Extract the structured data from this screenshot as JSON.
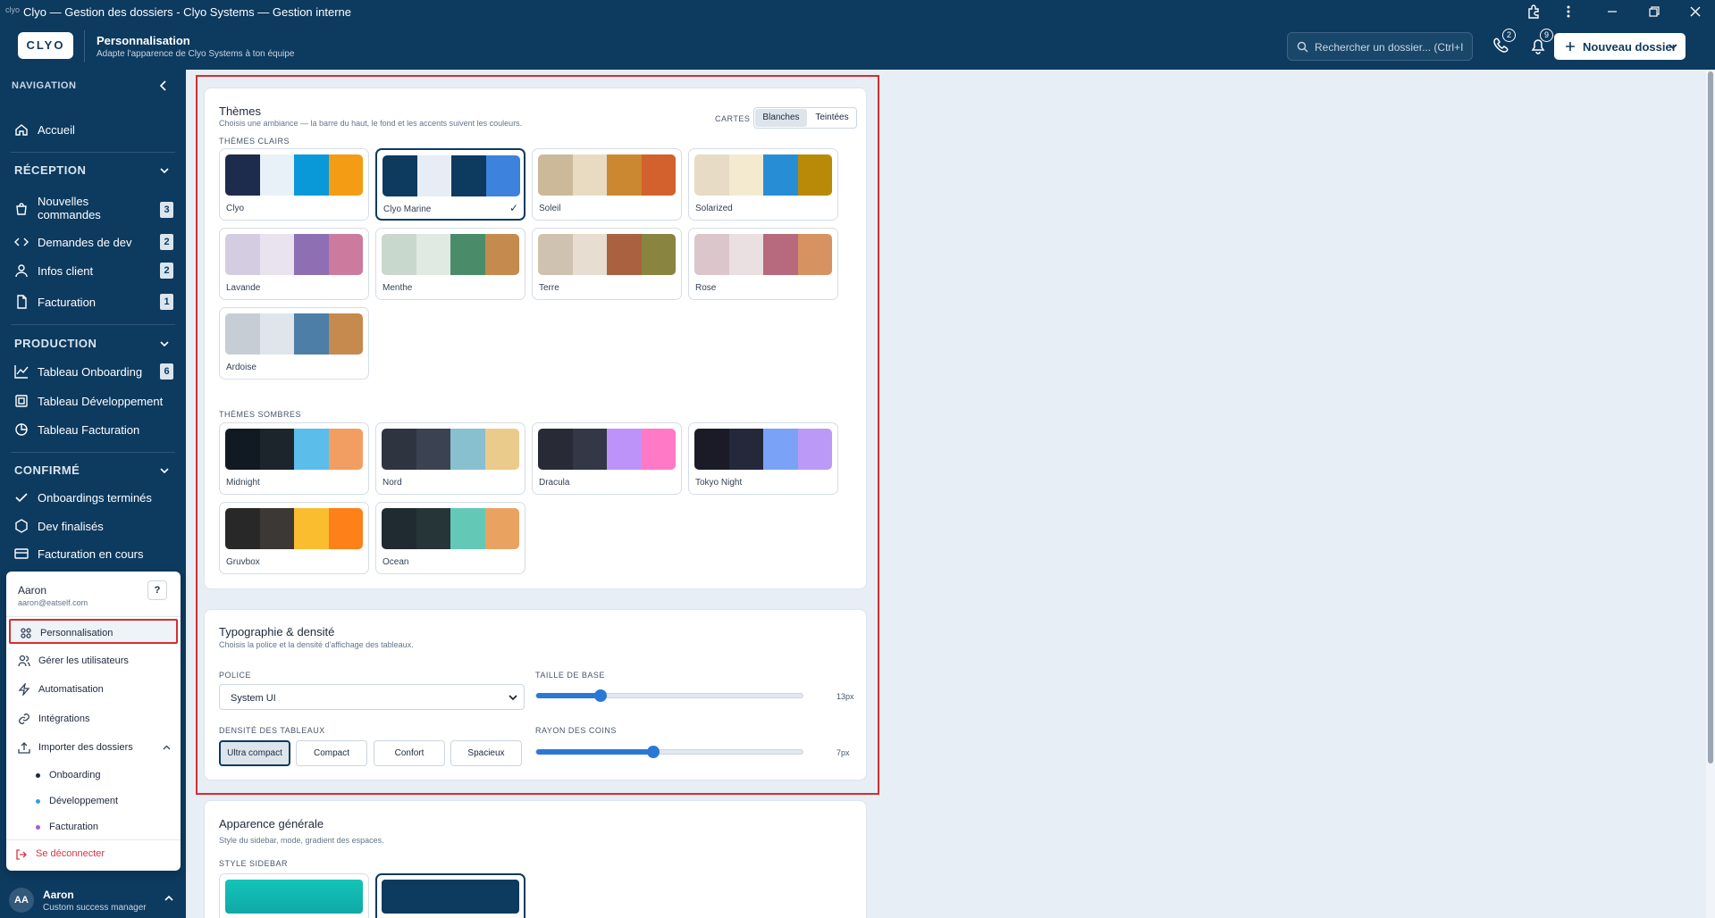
{
  "titlebar": {
    "logo_text": "clyo",
    "title": "Clyo — Gestion des dossiers - Clyo Systems — Gestion interne"
  },
  "header": {
    "logo": "CLYO",
    "title": "Personnalisation",
    "subtitle": "Adapte l'apparence de Clyo Systems à ton équipe",
    "search_placeholder": "Rechercher un dossier...  (Ctrl+I",
    "calls_count": "2",
    "notifications_count": "9",
    "new_button": "Nouveau dossier"
  },
  "sidebar": {
    "nav_heading": "NAVIGATION",
    "home": "Accueil",
    "sections": [
      {
        "title": "RÉCEPTION",
        "items": [
          {
            "label": "Nouvelles commandes",
            "count": "3"
          },
          {
            "label": "Demandes de dev",
            "count": "2"
          },
          {
            "label": "Infos client",
            "count": "2"
          },
          {
            "label": "Facturation",
            "count": "1"
          }
        ]
      },
      {
        "title": "PRODUCTION",
        "items": [
          {
            "label": "Tableau Onboarding",
            "count": "6"
          },
          {
            "label": "Tableau Développement"
          },
          {
            "label": "Tableau Facturation"
          }
        ]
      },
      {
        "title": "CONFIRMÉ",
        "items": [
          {
            "label": "Onboardings terminés"
          },
          {
            "label": "Dev finalisés"
          },
          {
            "label": "Facturation en cours"
          }
        ]
      }
    ],
    "nouvelles_line1": "Nouvelles",
    "nouvelles_line2": "commandes"
  },
  "popup": {
    "name": "Aaron",
    "email": "aaron@eatself.com",
    "help": "?",
    "items": [
      "Personnalisation",
      "Gérer les utilisateurs",
      "Automatisation",
      "Intégrations",
      "Importer des dossiers"
    ],
    "sub_items": [
      "Onboarding",
      "Développement",
      "Facturation"
    ],
    "logout": "Se déconnecter"
  },
  "user": {
    "initials": "AA",
    "name": "Aaron",
    "role": "Custom success manager"
  },
  "themes": {
    "title": "Thèmes",
    "subtitle": "Choisis une ambiance — la barre du haut, le fond et les accents suivent les couleurs.",
    "cards_label": "CARTES",
    "cards_options": [
      "Blanches",
      "Teintées"
    ],
    "light_heading": "THÈMES CLAIRS",
    "dark_heading": "THÈMES SOMBRES",
    "light": [
      {
        "name": "Clyo",
        "colors": [
          "#1d2b4d",
          "#e8f1f8",
          "#0999d8",
          "#f49c13"
        ]
      },
      {
        "name": "Clyo Marine",
        "colors": [
          "#0d3a5f",
          "#e6edf5",
          "#0d3a5f",
          "#3d82dc"
        ],
        "selected": true
      },
      {
        "name": "Soleil",
        "colors": [
          "#ccb99a",
          "#e9dbc1",
          "#cb8830",
          "#d2612e"
        ]
      },
      {
        "name": "Solarized",
        "colors": [
          "#e8dbc6",
          "#f4eacf",
          "#278ed6",
          "#b88a07"
        ]
      },
      {
        "name": "Lavande",
        "colors": [
          "#d4cde1",
          "#e8e3ef",
          "#8f6fb3",
          "#cc7a9d"
        ]
      },
      {
        "name": "Menthe",
        "colors": [
          "#c8d8cc",
          "#e0eae2",
          "#4a8c6a",
          "#c58a4e"
        ]
      },
      {
        "name": "Terre",
        "colors": [
          "#cfc2b0",
          "#e7ddd0",
          "#a9613f",
          "#8a8441"
        ]
      },
      {
        "name": "Rose",
        "colors": [
          "#dbc6cb",
          "#eadfe1",
          "#b66a7b",
          "#d69361"
        ]
      },
      {
        "name": "Ardoise",
        "colors": [
          "#c7cdd4",
          "#e0e5eb",
          "#4d7ea8",
          "#c6894e"
        ]
      }
    ],
    "dark": [
      {
        "name": "Midnight",
        "colors": [
          "#111a22",
          "#1c252c",
          "#5bbdea",
          "#f29e63"
        ]
      },
      {
        "name": "Nord",
        "colors": [
          "#2e3440",
          "#3b4252",
          "#88c0d0",
          "#ebcb8b"
        ]
      },
      {
        "name": "Dracula",
        "colors": [
          "#282a36",
          "#343746",
          "#bd93f9",
          "#ff79c6"
        ]
      },
      {
        "name": "Tokyo Night",
        "colors": [
          "#1a1b26",
          "#24283b",
          "#7aa2f7",
          "#bb9af7"
        ]
      },
      {
        "name": "Gruvbox",
        "colors": [
          "#282828",
          "#3c3836",
          "#fabd2f",
          "#fe8019"
        ]
      },
      {
        "name": "Ocean",
        "colors": [
          "#1f2b30",
          "#263538",
          "#63c9b6",
          "#eaa261"
        ]
      }
    ]
  },
  "typo": {
    "title": "Typographie & densité",
    "subtitle": "Choisis la police et la densité d'affichage des tableaux.",
    "font_label": "POLICE",
    "font_value": "System UI",
    "base_size_label": "TAILLE DE BASE",
    "base_size_value": "13px",
    "base_size_fraction": 0.24,
    "density_label": "DENSITÉ DES TABLEAUX",
    "density_options": [
      "Ultra compact",
      "Compact",
      "Confort",
      "Spacieux"
    ],
    "radius_label": "RAYON DES COINS",
    "radius_value": "7px",
    "radius_fraction": 0.44
  },
  "appearance": {
    "title": "Apparence générale",
    "subtitle": "Style du sidebar, mode, gradient des espaces.",
    "sidebar_style_label": "STYLE SIDEBAR"
  }
}
